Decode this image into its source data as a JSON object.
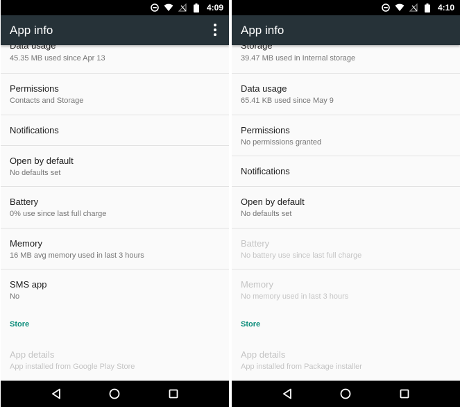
{
  "left": {
    "status": {
      "time": "4:09"
    },
    "appbar": {
      "title": "App info"
    },
    "items": [
      {
        "title": "Data usage",
        "subtitle": "45.35 MB used since Apr 13"
      },
      {
        "title": "Permissions",
        "subtitle": "Contacts and Storage"
      },
      {
        "title": "Notifications"
      },
      {
        "title": "Open by default",
        "subtitle": "No defaults set"
      },
      {
        "title": "Battery",
        "subtitle": "0% use since last full charge"
      },
      {
        "title": "Memory",
        "subtitle": "16 MB avg memory used in last 3 hours"
      },
      {
        "title": "SMS app",
        "subtitle": "No"
      }
    ],
    "section": "Store",
    "store_item": {
      "title": "App details",
      "subtitle": "App installed from Google Play Store"
    }
  },
  "right": {
    "status": {
      "time": "4:10"
    },
    "appbar": {
      "title": "App info"
    },
    "items": [
      {
        "title": "Storage",
        "subtitle": "39.47 MB used in Internal storage"
      },
      {
        "title": "Data usage",
        "subtitle": "65.41 KB used since May 9"
      },
      {
        "title": "Permissions",
        "subtitle": "No permissions granted"
      },
      {
        "title": "Notifications"
      },
      {
        "title": "Open by default",
        "subtitle": "No defaults set"
      },
      {
        "title": "Battery",
        "subtitle": "No battery use since last full charge"
      },
      {
        "title": "Memory",
        "subtitle": "No memory used in last 3 hours"
      }
    ],
    "section": "Store",
    "store_item": {
      "title": "App details",
      "subtitle": "App installed from Package installer"
    }
  },
  "colors": {
    "appbar": "#263238",
    "status_bar": "#000000",
    "section_accent": "#0a8c7a",
    "disabled_text": "#c4c4c4"
  },
  "icons": {
    "status": [
      "do-not-disturb-icon",
      "wifi-icon",
      "no-signal-icon",
      "battery-icon"
    ],
    "nav": [
      "back-icon",
      "home-icon",
      "recents-icon"
    ],
    "appbar": [
      "overflow-menu-icon"
    ]
  }
}
